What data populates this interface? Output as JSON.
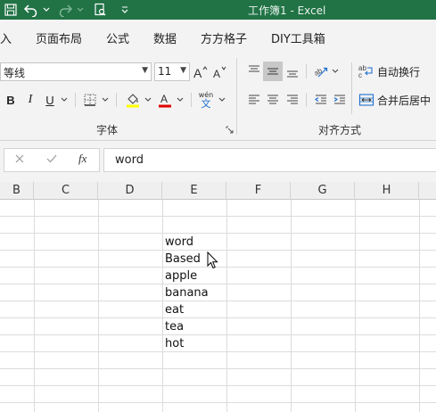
{
  "window": {
    "title": "工作簿1  -  Excel"
  },
  "menu_tabs": [
    "入",
    "页面布局",
    "公式",
    "数据",
    "方方格子",
    "DIY工具箱"
  ],
  "font": {
    "name": "等线",
    "size": "11",
    "bold": "B",
    "italic": "I",
    "underline": "U",
    "phonetic_top": "wén",
    "phonetic_bottom": "文",
    "font_color": "#e00000",
    "highlight_color": "#ffff00",
    "group_label": "字体"
  },
  "alignment": {
    "wrap_text_label": "自动换行",
    "merge_center_label": "合并后居中",
    "group_label": "对齐方式"
  },
  "formula_bar": {
    "value": "word",
    "fx": "fx"
  },
  "columns": [
    "B",
    "C",
    "D",
    "E",
    "F",
    "G",
    "H"
  ],
  "cells_column_E": [
    "word",
    "Based",
    "apple",
    "banana",
    "eat",
    "tea",
    "hot"
  ],
  "colors": {
    "accent": "#217346",
    "ribbon_bg": "#f3f3f3",
    "gridline": "#dcdcdc"
  }
}
